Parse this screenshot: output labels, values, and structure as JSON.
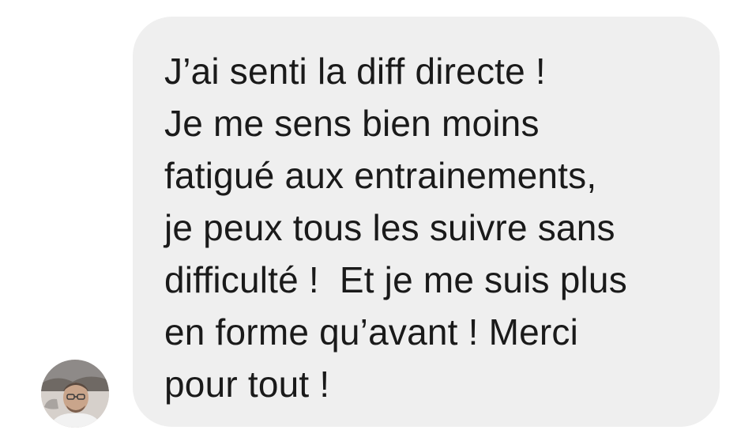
{
  "message": {
    "lines": [
      "J’ai senti la diff directe !",
      "Je me sens bien moins",
      "fatigué aux entrainements,",
      "je peux tous les suivre sans",
      "difficulté !  Et je me suis plus",
      "en forme qu’avant ! Merci",
      "pour tout !"
    ]
  },
  "colors": {
    "bubble_background": "#efefef",
    "text": "#1a1a1a",
    "page_background": "#ffffff"
  },
  "icons": {
    "avatar": "user-avatar-photo"
  }
}
